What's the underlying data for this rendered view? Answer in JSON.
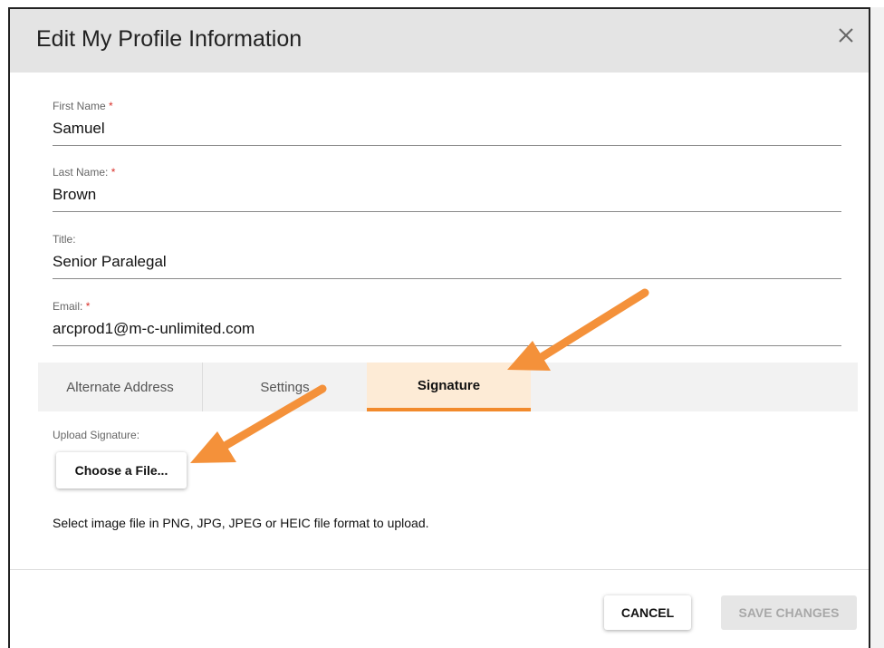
{
  "dialog": {
    "title": "Edit My Profile Information",
    "close_icon": "close-icon"
  },
  "fields": [
    {
      "label": "First Name",
      "required_mark": "*",
      "value": "Samuel"
    },
    {
      "label": "Last Name:",
      "required_mark": "*",
      "value": "Brown"
    },
    {
      "label": "Title:",
      "required_mark": "",
      "value": "Senior Paralegal"
    },
    {
      "label": "Email:",
      "required_mark": "*",
      "value": "arcprod1@m-c-unlimited.com"
    }
  ],
  "tabs": [
    {
      "label": "Alternate Address",
      "active": false
    },
    {
      "label": "Settings",
      "active": false
    },
    {
      "label": "Signature",
      "active": true
    }
  ],
  "signature": {
    "upload_label": "Upload Signature:",
    "choose_button": "Choose a File...",
    "hint": "Select image file in PNG, JPG, JPEG or HEIC file format to upload."
  },
  "footer": {
    "cancel_label": "CANCEL",
    "save_label": "SAVE CHANGES"
  },
  "colors": {
    "accent": "#f28a2b",
    "active_tab_bg": "#fdebd6",
    "header_bg": "#e4e4e4",
    "required": "#d9302a",
    "annotation_arrow": "#f4913a"
  }
}
